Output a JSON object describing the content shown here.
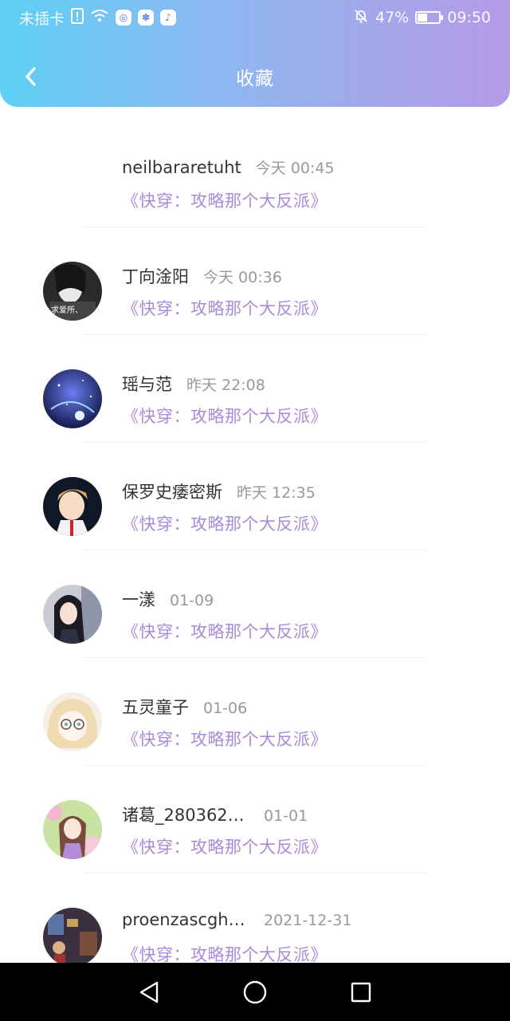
{
  "status_bar": {
    "carrier": "未插卡",
    "battery_percent": "47%",
    "battery_level": 0.47,
    "time": "09:50"
  },
  "header": {
    "title": "收藏",
    "gradient_start": "#5fd0f5",
    "gradient_end": "#b59ae8"
  },
  "favorites": [
    {
      "name": "neilbararetuht",
      "time": "今天 00:45",
      "book": "《快穿：攻略那个大反派》",
      "avatar_icon": "none"
    },
    {
      "name": "丁向淦阳",
      "time": "今天 00:36",
      "book": "《快穿：攻略那个大反派》",
      "avatar_icon": "monochrome-girl-avatar",
      "avatar_caption": "求爱所、"
    },
    {
      "name": "瑶与范",
      "time": "昨天 22:08",
      "book": "《快穿：攻略那个大反派》",
      "avatar_icon": "starry-night-avatar"
    },
    {
      "name": "保罗史痿密斯",
      "time": "昨天 12:35",
      "book": "《快穿：攻略那个大反派》",
      "avatar_icon": "anime-boy-avatar"
    },
    {
      "name": "一漾",
      "time": "01-09",
      "book": "《快穿：攻略那个大反派》",
      "avatar_icon": "dark-hair-girl-avatar"
    },
    {
      "name": "五灵童子",
      "time": "01-06",
      "book": "《快穿：攻略那个大反派》",
      "avatar_icon": "glasses-girl-avatar"
    },
    {
      "name": "诸葛_2803620...",
      "time": "01-01",
      "book": "《快穿：攻略那个大反派》",
      "avatar_icon": "flower-girl-avatar"
    },
    {
      "name": "proenzascgho...",
      "time": "2021-12-31",
      "book": "《快穿：攻略那个大反派》",
      "avatar_icon": "room-scene-avatar"
    }
  ],
  "colors": {
    "book_title": "#a98bd8",
    "name": "#333333",
    "time": "#999999"
  }
}
